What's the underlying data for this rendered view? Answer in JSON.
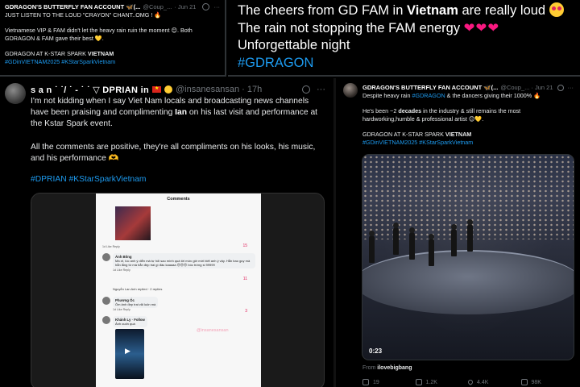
{
  "top_left": {
    "name": "GDRAGON'S BUTTERFLY FAN ACCOUNT 🦋(...",
    "handle": "@Coup_...",
    "time": "· Jun 21",
    "line1": "JUST LISTEN TO THE LOUD \"CRAYON\" CHANT..OMG ! 🔥",
    "line2": "Vietnamese VIP & FAM didn't let the heavy rain ruin the moment 😊. Both GDRAGON & FAM gave their best 💛.",
    "line3_prefix": "GDRAGON AT K-STAR SPARK ",
    "line3_bold": "VIETNAM",
    "tags": "#GDinVIETNAM2025 #KStarSparkVietnam"
  },
  "top_right": {
    "line1_prefix": "The cheers from GD FAM in ",
    "line1_bold": "Vietnam",
    "line1_suffix": " are really loud",
    "line2": "The rain not stopping the FAM energy",
    "line2_hearts": "❤❤❤",
    "line3": "Unforgettable night",
    "line4": "#GDRAGON"
  },
  "bottom_left": {
    "name": "s a n ˙ ˙/ ˙ - ˙ ˙ ▽ DPRIAN in",
    "handle": "@insanesansan · 17h",
    "para1_prefix": "I'm not kidding when I say Viet Nam locals and broadcasting news channels have been praising and complimenting ",
    "para1_bold": "Ian",
    "para1_suffix": " on his last visit and performance at the Kstar Spark event.",
    "para2": "All the comments are positive, they're all compliments on his looks, his music, and his performance 🫶",
    "tags": "#DPRIAN #KStarSparkVietnam",
    "screenshot": {
      "title": "Comments",
      "c1_name": "Ánh Bông",
      "c1_text": "Mà ơi, lúc anh ý diễn mà tự hỏi sao mình quá tới mức giờ mới biết anh ý vậy. Hẳn bao guy mà hẳn lắng từ mà hẳn đẹp trai gì đâu kaaaaa 😍😍😍 bóc trứng si 99999",
      "c1_meta": "1d   Like   Reply",
      "c1_count": "11",
      "reply_note": "Nguyễn Lan Anh replied · 2 replies",
      "c2_name": "Phương Ốc",
      "c2_text": "Ôm ảnh đẹp trai vãi luôn mà",
      "c2_meta": "1d   Like   Reply",
      "c2_count": "3",
      "c3_name": "Khánh Ly · Follow",
      "c3_text": "Ảnh cuốn quá",
      "watermark": "@insanesansan",
      "top_meta": "1d   Like   Reply",
      "top_count": "15"
    }
  },
  "bottom_right": {
    "name": "GDRAGON'S BUTTERFLY FAN ACCOUNT 🦋(...",
    "handle": "@Coup_... · Jun 21",
    "line1_prefix": "Despite heavy rain ",
    "line1_link": "#GDRAGON",
    "line1_suffix": " & the dancers giving their 1000% 🔥",
    "line2_prefix": "He's been ~2 ",
    "line2_bold": "decades",
    "line2_suffix": " in the industry & still remains the most hardworking,humble & professional artist 😊💛.",
    "line3_prefix": "GDRAGON AT K-STAR SPARK ",
    "line3_bold": "VIETNAM",
    "tags": "#GDinVIETNAM2025 #KStarSparkVietnam",
    "video_time": "0:23",
    "from_label": "From",
    "from_source": "ilovebigbang",
    "actions": {
      "replies": "19",
      "reposts": "1.2K",
      "likes": "4.4K",
      "views": "98K"
    }
  },
  "colors": {
    "link": "#1d9bf0",
    "background": "#000000",
    "muted": "#71767b",
    "heart": "#f91880"
  },
  "icons": [
    "grok-icon",
    "more-icon",
    "reply-icon",
    "repost-icon",
    "like-icon",
    "views-icon",
    "bookmark-icon",
    "share-icon",
    "play-icon"
  ]
}
